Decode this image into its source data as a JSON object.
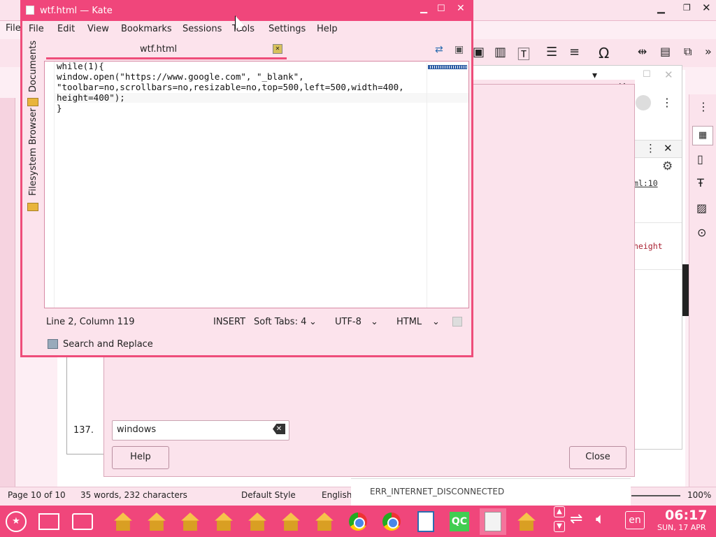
{
  "kate": {
    "title": "wtf.html  — Kate",
    "menu": [
      "File",
      "Edit",
      "View",
      "Bookmarks",
      "Sessions",
      "Tools",
      "Settings",
      "Help"
    ],
    "sidebar": {
      "documents": "Documents",
      "filesystem": "Filesystem Browser"
    },
    "tab_label": "wtf.html",
    "code_lines": [
      "while(1){",
      "window.open(\"https://www.google.com\", \"_blank\",",
      "\"toolbar=no,scrollbars=no,resizable=no,top=500,left=500,width=400,",
      "height=400\");",
      "}"
    ],
    "status": {
      "position": "Line 2, Column 119",
      "mode": "INSERT",
      "tabs": "Soft Tabs: 4",
      "encoding": "UTF-8",
      "syntax": "HTML"
    },
    "search_replace": "Search and Replace"
  },
  "dialog": {
    "input_value": "windows",
    "help_label": "Help",
    "close_label": "Close",
    "side_value": "137."
  },
  "browser": {
    "console_link": "ml:10",
    "console_text": "height",
    "error": "ERR_INTERNET_DISCONNECTED"
  },
  "writer": {
    "file_menu": "File",
    "status_page": "Page 10 of 10",
    "status_words": "35 words, 232 characters",
    "status_style": "Default Style",
    "status_lang": "English",
    "zoom": "100%"
  },
  "taskbar": {
    "lang": "en",
    "time": "06:17",
    "date": "SUN, 17 APR"
  },
  "colors": {
    "accent": "#f0467b",
    "bg": "#fbd3e1"
  }
}
